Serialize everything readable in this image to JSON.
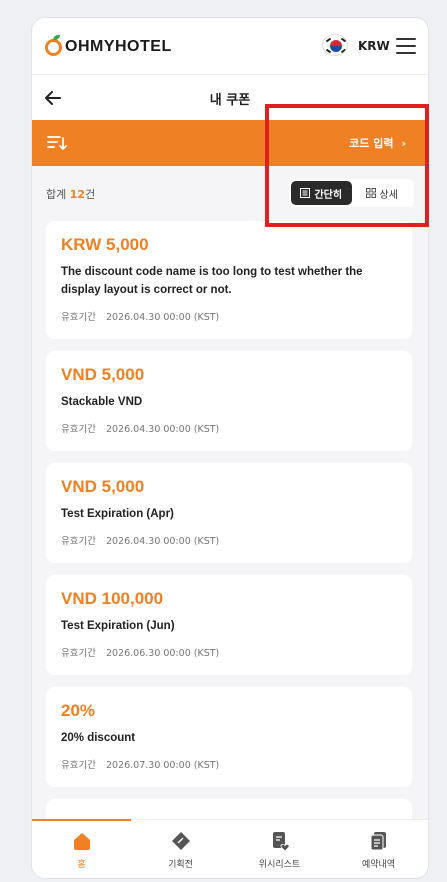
{
  "app": {
    "brand": "OHMYHOTEL",
    "currency": "KRW"
  },
  "header": {
    "title": "내 쿠폰"
  },
  "toolbar": {
    "code_entry": "코드 입력",
    "chevron": "›"
  },
  "summary": {
    "prefix": "합계 ",
    "count": "12",
    "suffix": "건"
  },
  "view_toggle": {
    "simple": "간단히",
    "detail": "상세",
    "selected": "simple"
  },
  "coupons": [
    {
      "amount": "KRW 5,000",
      "name": "The discount code name is too long to test whether the display layout is correct or not.",
      "validity_label": "유효기간",
      "validity": "2026.04.30 00:00 (KST)"
    },
    {
      "amount": "VND 5,000",
      "name": "Stackable VND",
      "validity_label": "유효기간",
      "validity": "2026.04.30 00:00 (KST)"
    },
    {
      "amount": "VND 5,000",
      "name": "Test Expiration (Apr)",
      "validity_label": "유효기간",
      "validity": "2026.04.30 00:00 (KST)"
    },
    {
      "amount": "VND 100,000",
      "name": "Test Expiration (Jun)",
      "validity_label": "유효기간",
      "validity": "2026.06.30 00:00 (KST)"
    },
    {
      "amount": "20%",
      "name": "20% discount",
      "validity_label": "유효기간",
      "validity": "2026.07.30 00:00 (KST)"
    }
  ],
  "bottom_nav": [
    {
      "label": "홈",
      "icon": "home-icon",
      "active": true
    },
    {
      "label": "기획전",
      "icon": "promotion-icon",
      "active": false
    },
    {
      "label": "위시리스트",
      "icon": "wishlist-icon",
      "active": false
    },
    {
      "label": "예약내역",
      "icon": "bookings-icon",
      "active": false
    }
  ],
  "colors": {
    "accent": "#f08024",
    "highlight": "#e02020"
  }
}
